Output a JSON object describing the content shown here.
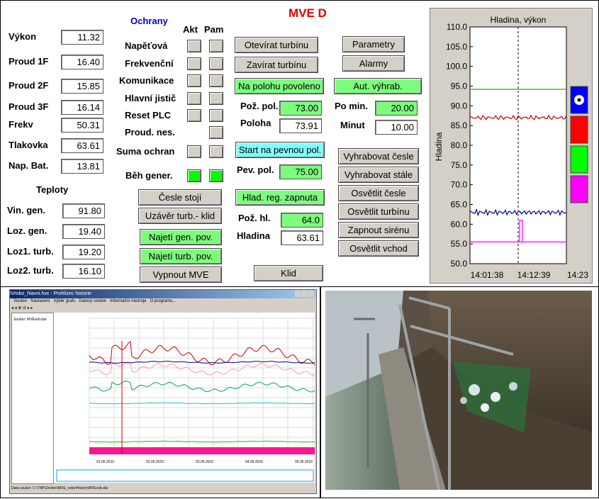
{
  "title": "MVE D",
  "left_params": [
    {
      "label": "Výkon",
      "value": "11.32"
    },
    {
      "label": "Proud 1F",
      "value": "16.40"
    },
    {
      "label": "Proud 2F",
      "value": "15.85"
    },
    {
      "label": "Proud 3F",
      "value": "16.14"
    },
    {
      "label": "Frekv",
      "value": "50.31"
    },
    {
      "label": "Tlakovka",
      "value": "63.61"
    },
    {
      "label": "Nap. Bat.",
      "value": "13.81"
    }
  ],
  "teploty": {
    "header": "Teploty",
    "items": [
      {
        "label": "Vin. gen.",
        "value": "91.80"
      },
      {
        "label": "Loz. gen.",
        "value": "19.40"
      },
      {
        "label": "Loz1. turb.",
        "value": "19.20"
      },
      {
        "label": "Loz2. turb.",
        "value": "16.10"
      }
    ]
  },
  "ochrany": {
    "header": "Ochrany",
    "col_akt": "Akt",
    "col_pam": "Pam",
    "items": [
      {
        "label": "Napěťová",
        "akt": false,
        "pam": false
      },
      {
        "label": "Frekvenční",
        "akt": false,
        "pam": false
      },
      {
        "label": "Komunikace",
        "akt": false,
        "pam": false
      },
      {
        "label": "Hlavní jistič",
        "akt": false,
        "pam": false
      },
      {
        "label": "Reset PLC",
        "akt": false,
        "pam": false
      },
      {
        "label": "Proud. nes.",
        "akt": null,
        "pam": false
      },
      {
        "label": "Suma ochran",
        "akt": false,
        "pam": false
      }
    ],
    "beh_gener": {
      "label": "Běh gener.",
      "akt": true,
      "pam": true
    }
  },
  "mid_buttons": {
    "cesle_stoji": "Česle stojí",
    "uzaver": "Uzávěr turb.-  klid",
    "najeti_gen": "Najetí gen. pov.",
    "najeti_turb": "Najetí turb. pov.",
    "vypnout": "Vypnout MVE"
  },
  "turbine": {
    "otevirat": "Otevírat turbínu",
    "zavirat": "Zavírat turbínu",
    "na_polohu": "Na polohu povoleno",
    "poz_pol_label": "Pož. pol.",
    "poz_pol_value": "73.00",
    "poloha_label": "Poloha",
    "poloha_value": "73.91",
    "start": "Start na pevnou pol.",
    "pev_pol_label": "Pev. pol.",
    "pev_pol_value": "75.00",
    "hlad_reg": "Hlad. reg. zapnuta",
    "poz_hl_label": "Pož. hl.",
    "poz_hl_value": "64.0",
    "hladina_label": "Hladina",
    "hladina_value": "63.61",
    "klid": "Klid"
  },
  "right_buttons": {
    "parametry": "Parametry",
    "alarmy": "Alarmy",
    "aut_vyhrab": "Aut. výhrab.",
    "po_min_label": "Po min.",
    "po_min_value": "20.00",
    "minut_label": "Minut",
    "minut_value": "10.00",
    "vyhrabovat_cesle": "Vyhrabovat česle",
    "vyhrabovat_stale": "Vyhrabovat stále",
    "osvetlit_cesle": "Osvětlit česle",
    "osvetlit_turbinu": "Osvětlit turbínu",
    "zapnout_sirenu": "Zapnout sirénu",
    "osvetlit_vchod": "Osvětlit vchod"
  },
  "chart_data": {
    "type": "line",
    "title": "Hladina, výkon",
    "ylabel": "Hladina",
    "ylim": [
      50,
      110
    ],
    "yticks": [
      "110.0",
      "105.0",
      "100.0",
      "95.0",
      "90.0",
      "85.0",
      "80.0",
      "75.0",
      "70.0",
      "65.0",
      "60.0",
      "55.0",
      "50.0"
    ],
    "xticks": [
      "14:01:38",
      "14:12:39",
      "14:23"
    ],
    "grid": "none",
    "series": [
      {
        "color": "#00c000",
        "approx_level": 94.2
      },
      {
        "color": "#c00000",
        "approx_level": 87.0
      },
      {
        "color": "#00008b",
        "approx_level": 63.0
      },
      {
        "color": "#ff00ff",
        "approx_level": 55.5
      }
    ],
    "legend_swatches": [
      "#0000ff",
      "#ff0000",
      "#00ff00",
      "#ff00ff"
    ]
  },
  "history_window": {
    "title": "IVrobo_hlavni.hvc - Prohlizec historie",
    "menu": [
      "Soubor",
      "Nastavení",
      "Výběr grafu",
      "Datový soubor",
      "Informační nástroje",
      "O programu..."
    ],
    "status": "Data soubor: C:\\TNP\\IJ\\robo\\IMVE_vobo\\History\\MVEvob.dat",
    "file_label": "Soubor: MVEvob.dat",
    "x_dates": [
      "01.05.2010",
      "02.05.2010",
      "03.05.2010",
      "04.05.2010",
      "05.05.2010"
    ]
  },
  "colors": {
    "accent_green": "#7dfc7d",
    "accent_cyan": "#80ffff",
    "title_red": "#e00000",
    "ochrany_blue": "#0000c0"
  }
}
